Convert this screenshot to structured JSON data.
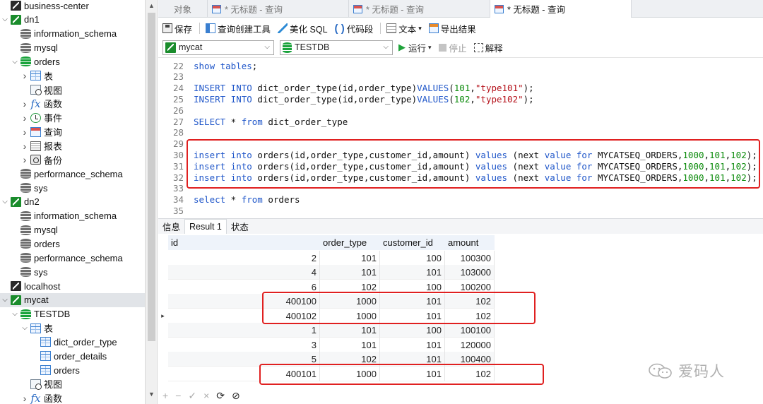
{
  "sidebar": {
    "items": [
      {
        "label": "business-center",
        "level": 0,
        "chevron": "",
        "icon": "connection-gray",
        "selected": false
      },
      {
        "label": "dn1",
        "level": 0,
        "chevron": "expanded",
        "icon": "connection",
        "selected": false
      },
      {
        "label": "information_schema",
        "level": 1,
        "chevron": "",
        "icon": "database",
        "selected": false
      },
      {
        "label": "mysql",
        "level": 1,
        "chevron": "",
        "icon": "database",
        "selected": false
      },
      {
        "label": "orders",
        "level": 1,
        "chevron": "expanded",
        "icon": "database-green",
        "selected": false
      },
      {
        "label": "表",
        "level": 2,
        "chevron": "collapsed",
        "icon": "table",
        "selected": false
      },
      {
        "label": "视图",
        "level": 2,
        "chevron": "",
        "icon": "view",
        "selected": false
      },
      {
        "label": "函数",
        "level": 2,
        "chevron": "collapsed",
        "icon": "function",
        "selected": false
      },
      {
        "label": "事件",
        "level": 2,
        "chevron": "collapsed",
        "icon": "event",
        "selected": false
      },
      {
        "label": "查询",
        "level": 2,
        "chevron": "collapsed",
        "icon": "query",
        "selected": false
      },
      {
        "label": "报表",
        "level": 2,
        "chevron": "collapsed",
        "icon": "report",
        "selected": false
      },
      {
        "label": "备份",
        "level": 2,
        "chevron": "collapsed",
        "icon": "backup",
        "selected": false
      },
      {
        "label": "performance_schema",
        "level": 1,
        "chevron": "",
        "icon": "database",
        "selected": false
      },
      {
        "label": "sys",
        "level": 1,
        "chevron": "",
        "icon": "database",
        "selected": false
      },
      {
        "label": "dn2",
        "level": 0,
        "chevron": "expanded",
        "icon": "connection",
        "selected": false
      },
      {
        "label": "information_schema",
        "level": 1,
        "chevron": "",
        "icon": "database",
        "selected": false
      },
      {
        "label": "mysql",
        "level": 1,
        "chevron": "",
        "icon": "database",
        "selected": false
      },
      {
        "label": "orders",
        "level": 1,
        "chevron": "",
        "icon": "database",
        "selected": false
      },
      {
        "label": "performance_schema",
        "level": 1,
        "chevron": "",
        "icon": "database",
        "selected": false
      },
      {
        "label": "sys",
        "level": 1,
        "chevron": "",
        "icon": "database",
        "selected": false
      },
      {
        "label": "localhost",
        "level": 0,
        "chevron": "",
        "icon": "connection-gray",
        "selected": false
      },
      {
        "label": "mycat",
        "level": 0,
        "chevron": "expanded",
        "icon": "connection",
        "selected": true
      },
      {
        "label": "TESTDB",
        "level": 1,
        "chevron": "expanded",
        "icon": "database-green",
        "selected": false
      },
      {
        "label": "表",
        "level": 2,
        "chevron": "expanded",
        "icon": "table",
        "selected": false
      },
      {
        "label": "dict_order_type",
        "level": 3,
        "chevron": "",
        "icon": "table",
        "selected": false
      },
      {
        "label": "order_details",
        "level": 3,
        "chevron": "",
        "icon": "table",
        "selected": false
      },
      {
        "label": "orders",
        "level": 3,
        "chevron": "",
        "icon": "table",
        "selected": false
      },
      {
        "label": "视图",
        "level": 2,
        "chevron": "",
        "icon": "view",
        "selected": false
      },
      {
        "label": "函数",
        "level": 2,
        "chevron": "collapsed",
        "icon": "function",
        "selected": false
      }
    ]
  },
  "tabs": [
    {
      "label": "对象",
      "active": false,
      "icon": false
    },
    {
      "label": "* 无标题 - 查询",
      "active": false,
      "icon": true
    },
    {
      "label": "* 无标题 - 查询",
      "active": false,
      "icon": true
    },
    {
      "label": "* 无标题 - 查询",
      "active": true,
      "icon": true
    }
  ],
  "toolbar": {
    "save": "保存",
    "query_builder": "查询创建工具",
    "beautify_sql": "美化 SQL",
    "code_snippet": "代码段",
    "text": "文本",
    "export_result": "导出结果",
    "connection": "mycat",
    "database": "TESTDB",
    "run": "运行",
    "stop": "停止",
    "explain": "解释"
  },
  "editor": {
    "lines": [
      {
        "n": 22,
        "tokens": [
          [
            "kw",
            "show tables"
          ],
          [
            "txt",
            ";"
          ]
        ]
      },
      {
        "n": 23,
        "tokens": []
      },
      {
        "n": 24,
        "tokens": [
          [
            "kw",
            "INSERT INTO"
          ],
          [
            "txt",
            " dict_order_type(id,order_type)"
          ],
          [
            "kw",
            "VALUES"
          ],
          [
            "txt",
            "("
          ],
          [
            "num",
            "101"
          ],
          [
            "txt",
            ","
          ],
          [
            "str",
            "\"type101\""
          ],
          [
            "txt",
            ");"
          ]
        ]
      },
      {
        "n": 25,
        "tokens": [
          [
            "kw",
            "INSERT INTO"
          ],
          [
            "txt",
            " dict_order_type(id,order_type)"
          ],
          [
            "kw",
            "VALUES"
          ],
          [
            "txt",
            "("
          ],
          [
            "num",
            "102"
          ],
          [
            "txt",
            ","
          ],
          [
            "str",
            "\"type102\""
          ],
          [
            "txt",
            ");"
          ]
        ]
      },
      {
        "n": 26,
        "tokens": []
      },
      {
        "n": 27,
        "tokens": [
          [
            "kw",
            "SELECT"
          ],
          [
            "txt",
            " * "
          ],
          [
            "kw",
            "from"
          ],
          [
            "txt",
            " dict_order_type"
          ]
        ]
      },
      {
        "n": 28,
        "tokens": []
      },
      {
        "n": 29,
        "tokens": []
      },
      {
        "n": 30,
        "tokens": [
          [
            "kw",
            "insert into"
          ],
          [
            "txt",
            " orders(id,order_type,customer_id,amount) "
          ],
          [
            "kw",
            "values"
          ],
          [
            "txt",
            " (next "
          ],
          [
            "kw",
            "value for"
          ],
          [
            "txt",
            " MYCATSEQ_ORDERS,"
          ],
          [
            "num",
            "1000"
          ],
          [
            "txt",
            ","
          ],
          [
            "num",
            "101"
          ],
          [
            "txt",
            ","
          ],
          [
            "num",
            "102"
          ],
          [
            "txt",
            ");"
          ]
        ]
      },
      {
        "n": 31,
        "tokens": [
          [
            "kw",
            "insert into"
          ],
          [
            "txt",
            " orders(id,order_type,customer_id,amount) "
          ],
          [
            "kw",
            "values"
          ],
          [
            "txt",
            " (next "
          ],
          [
            "kw",
            "value for"
          ],
          [
            "txt",
            " MYCATSEQ_ORDERS,"
          ],
          [
            "num",
            "1000"
          ],
          [
            "txt",
            ","
          ],
          [
            "num",
            "101"
          ],
          [
            "txt",
            ","
          ],
          [
            "num",
            "102"
          ],
          [
            "txt",
            ");"
          ]
        ]
      },
      {
        "n": 32,
        "tokens": [
          [
            "kw",
            "insert into"
          ],
          [
            "txt",
            " orders(id,order_type,customer_id,amount) "
          ],
          [
            "kw",
            "values"
          ],
          [
            "txt",
            " (next "
          ],
          [
            "kw",
            "value for"
          ],
          [
            "txt",
            " MYCATSEQ_ORDERS,"
          ],
          [
            "num",
            "1000"
          ],
          [
            "txt",
            ","
          ],
          [
            "num",
            "101"
          ],
          [
            "txt",
            ","
          ],
          [
            "num",
            "102"
          ],
          [
            "txt",
            ");"
          ]
        ]
      },
      {
        "n": 33,
        "tokens": []
      },
      {
        "n": 34,
        "tokens": [
          [
            "kw",
            "select"
          ],
          [
            "txt",
            " * "
          ],
          [
            "kw",
            "from"
          ],
          [
            "txt",
            " orders"
          ]
        ]
      },
      {
        "n": 35,
        "tokens": []
      }
    ]
  },
  "result_tabs": [
    {
      "label": "信息",
      "active": false
    },
    {
      "label": "Result 1",
      "active": true
    },
    {
      "label": "状态",
      "active": false
    }
  ],
  "grid": {
    "columns": [
      "id",
      "order_type",
      "customer_id",
      "amount"
    ],
    "rows": [
      [
        "2",
        "101",
        "100",
        "100300"
      ],
      [
        "4",
        "101",
        "101",
        "103000"
      ],
      [
        "6",
        "102",
        "100",
        "100200"
      ],
      [
        "400100",
        "1000",
        "101",
        "102"
      ],
      [
        "400102",
        "1000",
        "101",
        "102"
      ],
      [
        "1",
        "101",
        "100",
        "100100"
      ],
      [
        "3",
        "101",
        "101",
        "120000"
      ],
      [
        "5",
        "102",
        "101",
        "100400"
      ],
      [
        "400101",
        "1000",
        "101",
        "102"
      ]
    ],
    "current_row": 4
  },
  "footer": {
    "buttons": [
      "+",
      "−",
      "✓",
      "×",
      "⟳",
      "⊘"
    ]
  },
  "watermark": "爱码人",
  "colors": {
    "highlight_border": "#e02020",
    "keyword": "#1f56c9",
    "string": "#b5121b",
    "number": "#0a8a0a"
  }
}
